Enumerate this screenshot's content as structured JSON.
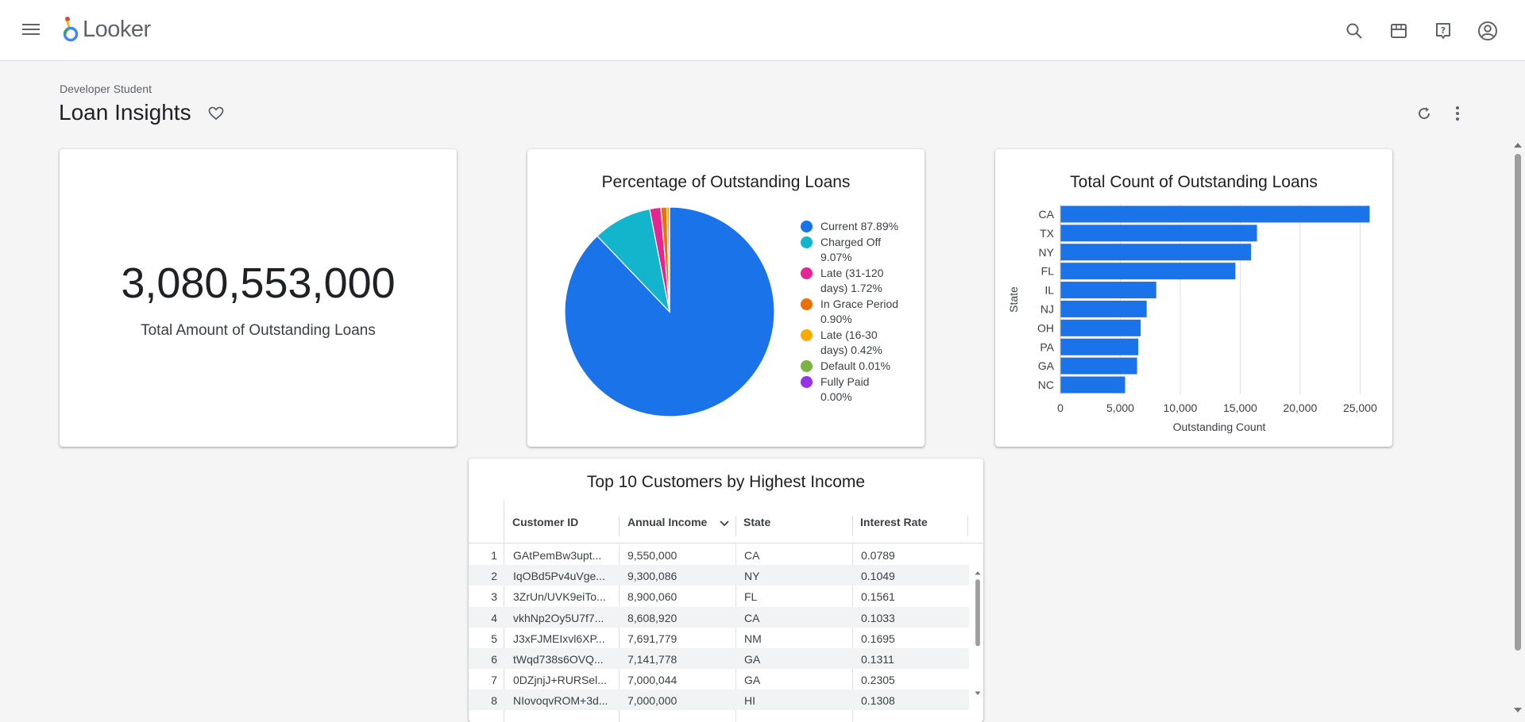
{
  "app": {
    "name": "Looker"
  },
  "header": {
    "icons": [
      "search-icon",
      "marketplace-icon",
      "help-icon",
      "account-icon"
    ]
  },
  "dashboard": {
    "breadcrumb": "Developer Student",
    "title": "Loan Insights"
  },
  "kpi": {
    "value": "3,080,553,000",
    "label": "Total Amount of Outstanding Loans"
  },
  "chart_data": [
    {
      "type": "pie",
      "title": "Percentage of Outstanding Loans",
      "slices": [
        {
          "label": "Current",
          "value": 87.89,
          "display": "Current 87.89%",
          "color": "#1a73e8"
        },
        {
          "label": "Charged Off",
          "value": 9.07,
          "display": "Charged Off 9.07%",
          "color": "#12b5cb"
        },
        {
          "label": "Late (31-120 days)",
          "value": 1.72,
          "display": "Late (31-120 days) 1.72%",
          "color": "#e52592"
        },
        {
          "label": "In Grace Period",
          "value": 0.9,
          "display": "In Grace Period 0.90%",
          "color": "#e8710a"
        },
        {
          "label": "Late (16-30 days)",
          "value": 0.42,
          "display": "Late (16-30 days) 0.42%",
          "color": "#f9ab00"
        },
        {
          "label": "Default",
          "value": 0.01,
          "display": "Default 0.01%",
          "color": "#7cb342"
        },
        {
          "label": "Fully Paid",
          "value": 0.0,
          "display": "Fully Paid 0.00%",
          "color": "#9334e6"
        }
      ]
    },
    {
      "type": "bar",
      "orientation": "horizontal",
      "title": "Total Count of Outstanding Loans",
      "ylabel": "State",
      "xlabel": "Outstanding Count",
      "categories": [
        "CA",
        "TX",
        "NY",
        "FL",
        "IL",
        "NJ",
        "OH",
        "PA",
        "GA",
        "NC"
      ],
      "values": [
        25800,
        16400,
        15900,
        14600,
        8000,
        7200,
        6700,
        6500,
        6400,
        5400
      ],
      "xlim": [
        0,
        26500
      ],
      "xticks": [
        0,
        5000,
        10000,
        15000,
        20000,
        25000
      ],
      "xtick_labels": [
        "0",
        "5,000",
        "10,000",
        "15,000",
        "20,000",
        "25,000"
      ],
      "color": "#1a73e8",
      "grid": true
    }
  ],
  "table": {
    "title": "Top 10 Customers by Highest Income",
    "columns": [
      "Customer ID",
      "Annual Income",
      "State",
      "Interest Rate"
    ],
    "sorted_column": "Annual Income",
    "rows": [
      {
        "num": "1",
        "id": "GAtPemBw3upt...",
        "income": "9,550,000",
        "state": "CA",
        "rate": "0.0789"
      },
      {
        "num": "2",
        "id": "IqOBd5Pv4uVge...",
        "income": "9,300,086",
        "state": "NY",
        "rate": "0.1049"
      },
      {
        "num": "3",
        "id": "3ZrUn/UVK9eiTo...",
        "income": "8,900,060",
        "state": "FL",
        "rate": "0.1561"
      },
      {
        "num": "4",
        "id": "vkhNp2Oy5U7f7...",
        "income": "8,608,920",
        "state": "CA",
        "rate": "0.1033"
      },
      {
        "num": "5",
        "id": "J3xFJMEIxvl6XP...",
        "income": "7,691,779",
        "state": "NM",
        "rate": "0.1695"
      },
      {
        "num": "6",
        "id": "tWqd738s6OVQ...",
        "income": "7,141,778",
        "state": "GA",
        "rate": "0.1311"
      },
      {
        "num": "7",
        "id": "0DZjnjJ+RURSel...",
        "income": "7,000,044",
        "state": "GA",
        "rate": "0.2305"
      },
      {
        "num": "8",
        "id": "NIovoqvROM+3d...",
        "income": "7,000,000",
        "state": "HI",
        "rate": "0.1308"
      }
    ]
  }
}
